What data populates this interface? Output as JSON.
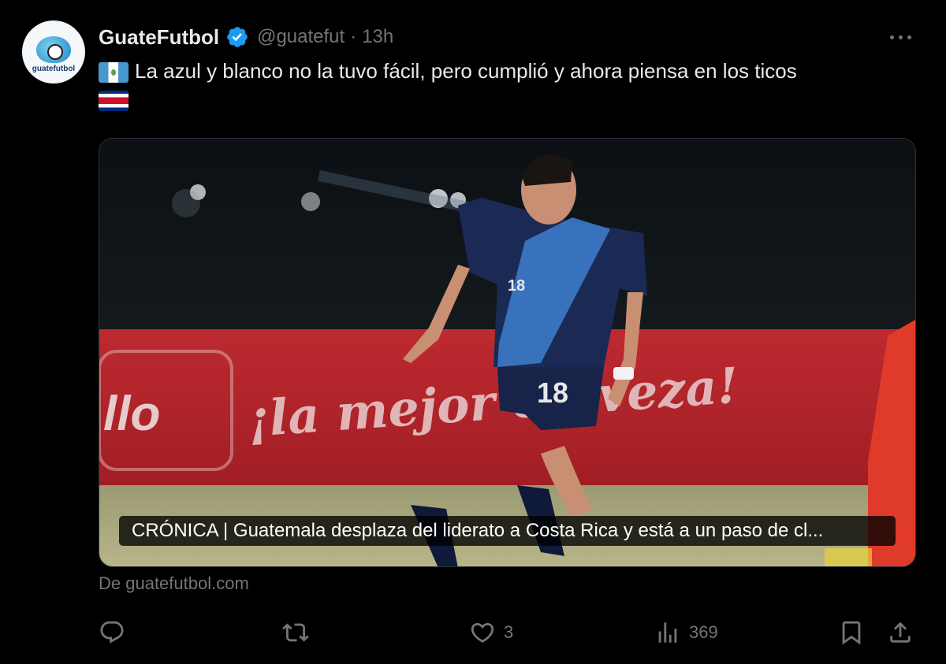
{
  "tweet": {
    "display_name": "GuateFutbol",
    "handle": "@guatefut",
    "separator": "·",
    "time": "13h",
    "avatar_text": "guatefutbol",
    "text": "La azul y blanco no la tuvo fácil, pero cumplió y ahora piensa en los ticos",
    "flags": [
      "guatemala-flag",
      "costa-rica-flag"
    ]
  },
  "card": {
    "ad_board_text": "¡la mejor cerveza!",
    "ad_brand_text": "llo",
    "jersey_number": "18",
    "caption": "CRÓNICA | Guatemala desplaza del liderato a Costa Rica y está a un paso de cl...",
    "source": "De guatefutbol.com"
  },
  "actions": {
    "reply_count": "",
    "retweet_count": "",
    "like_count": "3",
    "views_count": "369"
  },
  "colors": {
    "background": "#000000",
    "text": "#e7e9ea",
    "muted": "#71767b",
    "verified": "#1d9bf0",
    "ad_board": "#b0242a"
  }
}
